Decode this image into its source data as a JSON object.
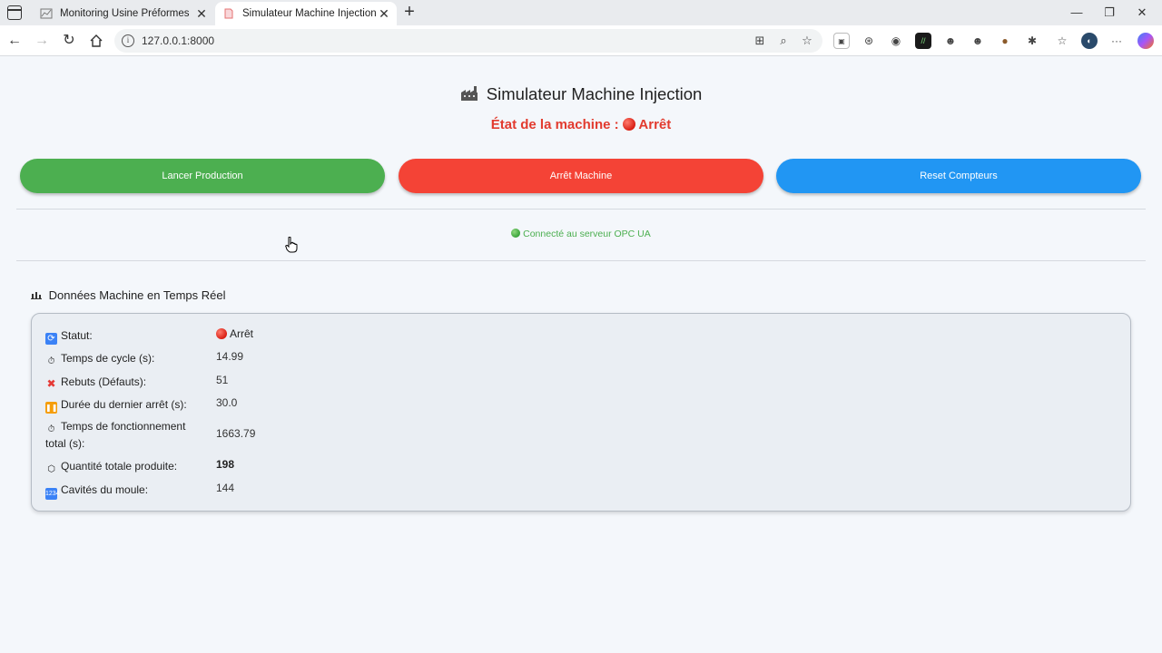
{
  "browser": {
    "tabs": [
      {
        "title": "Monitoring Usine Préformes",
        "favicon": "chart-favicon-icon",
        "active": false
      },
      {
        "title": "Simulateur Machine Injection",
        "favicon": "page-favicon-icon",
        "active": true
      }
    ],
    "url": "127.0.0.1:8000"
  },
  "page": {
    "title_icon": "🏭",
    "title": "Simulateur Machine Injection",
    "machine_state_label": "État de la machine :",
    "machine_state_value": "Arrêt",
    "buttons": {
      "start": "Lancer Production",
      "stop": "Arrêt Machine",
      "reset": "Reset Compteurs"
    },
    "opc_status": "Connecté au serveur OPC UA",
    "section_title": "Données Machine en Temps Réel",
    "data": {
      "status_label": "Statut:",
      "status_value": "Arrêt",
      "cycle_label": "Temps de cycle (s):",
      "cycle_value": "14.99",
      "rejects_label": "Rebuts (Défauts):",
      "rejects_value": "51",
      "last_stop_label": "Durée du dernier arrêt (s):",
      "last_stop_value": "30.0",
      "runtime_label": "Temps de fonctionnement total (s):",
      "runtime_value": "1663.79",
      "total_qty_label": "Quantité totale produite:",
      "total_qty_value": "198",
      "cavities_label": "Cavités du moule:",
      "cavities_value": "144"
    }
  },
  "colors": {
    "green": "#4caf50",
    "red": "#f44336",
    "blue": "#2196f3",
    "state_red": "#e23b2e"
  }
}
